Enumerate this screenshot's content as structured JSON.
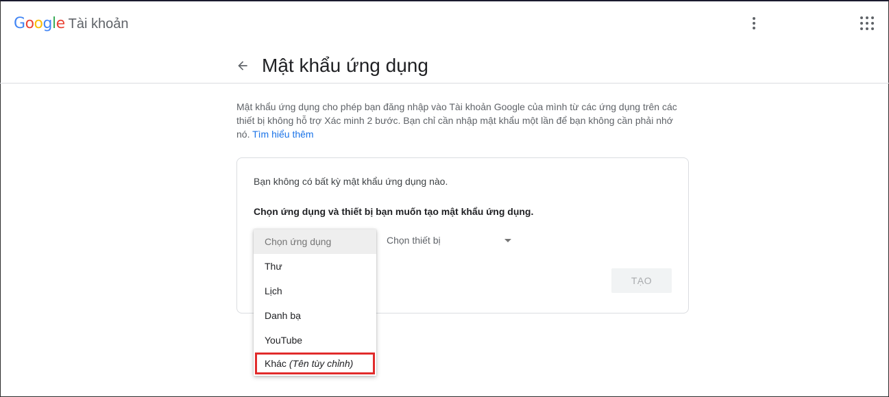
{
  "header": {
    "logo_letters": [
      {
        "ch": "G",
        "color": "#4285F4"
      },
      {
        "ch": "o",
        "color": "#EA4335"
      },
      {
        "ch": "o",
        "color": "#FBBC05"
      },
      {
        "ch": "g",
        "color": "#4285F4"
      },
      {
        "ch": "l",
        "color": "#34A853"
      },
      {
        "ch": "e",
        "color": "#EA4335"
      }
    ],
    "product_label": "Tài khoản",
    "icons": {
      "menu": "more-vert-icon",
      "apps": "apps-grid-icon"
    }
  },
  "page": {
    "title": "Mật khẩu ứng dụng",
    "description": "Mật khẩu ứng dụng cho phép bạn đăng nhập vào Tài khoản Google của mình từ các ứng dụng trên các thiết bị không hỗ trợ Xác minh 2 bước. Bạn chỉ cần nhập mật khẩu một lần để bạn không cần phải nhớ nó.",
    "learn_more": "Tìm hiểu thêm"
  },
  "card": {
    "no_passwords": "Bạn không có bất kỳ mật khẩu ứng dụng nào.",
    "instruction": "Chọn ứng dụng và thiết bị bạn muốn tạo mật khẩu ứng dụng.",
    "device_placeholder": "Chọn thiết bị",
    "create_label": "TẠO"
  },
  "app_dropdown": {
    "placeholder": "Chọn ứng dụng",
    "options": [
      "Thư",
      "Lịch",
      "Danh bạ",
      "YouTube"
    ],
    "other_label": "Khác",
    "other_hint": "(Tên tùy chỉnh)"
  },
  "colors": {
    "accent": "#1a73e8",
    "highlight_border": "#e12b2b"
  }
}
